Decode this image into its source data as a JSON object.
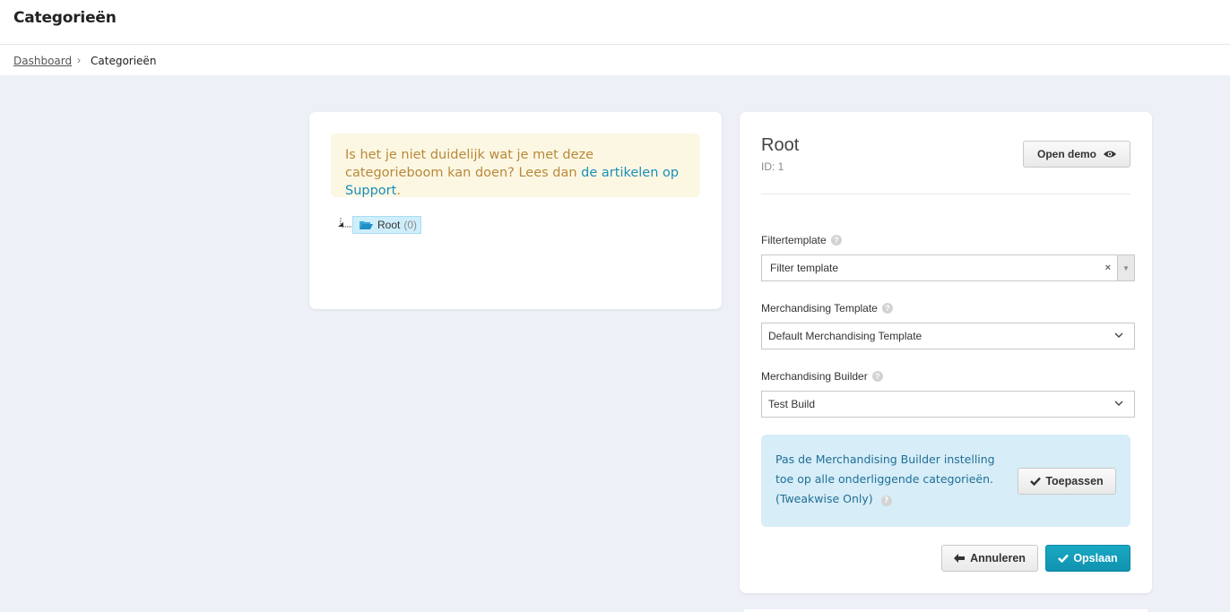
{
  "header": {
    "title": "Categorieën"
  },
  "breadcrumb": {
    "home": "Dashboard",
    "separator": "›",
    "current": "Categorieën"
  },
  "notice": {
    "text_before": "Is het je niet duidelijk wat je met deze categorieboom kan doen? Lees dan ",
    "link": "de artikelen op Support",
    "text_after": "."
  },
  "tree": {
    "node_label": "Root",
    "node_count": "(0)",
    "icon": "folder-open-icon"
  },
  "detail": {
    "title": "Root",
    "id_text": "ID: 1",
    "open_demo_label": "Open demo",
    "filter_label": "Filtertemplate",
    "filter_value": "Filter template",
    "filter_clear": "×",
    "filter_arrow": "▼",
    "mt_label": "Merchandising Template",
    "mt_value": "Default Merchandising Template",
    "mb_label": "Merchandising Builder",
    "mb_value": "Test Build",
    "help_glyph": "?",
    "info_text": "Pas de Merchandising Builder instelling toe op alle onderliggende categorieën. (Tweakwise Only)",
    "apply_label": "Toepassen",
    "cancel_label": "Annuleren",
    "save_label": "Opslaan"
  },
  "colors": {
    "background": "#eef0f8",
    "notice_bg": "#fcf7e3",
    "notice_text": "#b8893a",
    "link": "#1a8fb8",
    "info_bg": "#d7edf7",
    "info_text": "#1f6f98",
    "primary": "#1aa8c3"
  }
}
